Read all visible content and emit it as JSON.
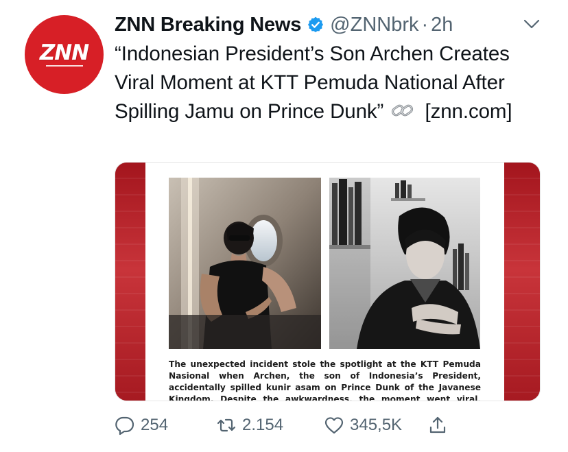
{
  "tweet": {
    "avatar_text": "ZNN",
    "display_name": "ZNN Breaking News",
    "handle": "@ZNNbrk",
    "separator": "·",
    "time": "2h",
    "body_text": "“Indonesian President’s Son Archen Creates Viral Moment at KTT Pemuda National After Spilling Jamu on Prince Dunk”",
    "link_text": "[znn.com]",
    "media": {
      "caption": "The unexpected incident stole the spotlight at the KTT Pemuda Nasional when Archen, the son of Indonesia’s President, accidentally spilled kunir asam on Prince Dunk of the Javanese Kingdom. Despite the awkwardness, the moment went viral, turning Archen into a"
    },
    "actions": {
      "replies": "254",
      "retweets": "2.154",
      "likes": "345,5K"
    }
  },
  "icons": {
    "verified": "verified-badge-icon",
    "caret": "chevron-down-icon",
    "link": "link-emoji-icon",
    "reply": "reply-icon",
    "retweet": "retweet-icon",
    "like": "heart-icon",
    "share": "share-icon"
  },
  "colors": {
    "avatar_bg": "#d71f26",
    "verified": "#1d9bf0",
    "muted_text": "#536471",
    "text": "#0f1419"
  }
}
